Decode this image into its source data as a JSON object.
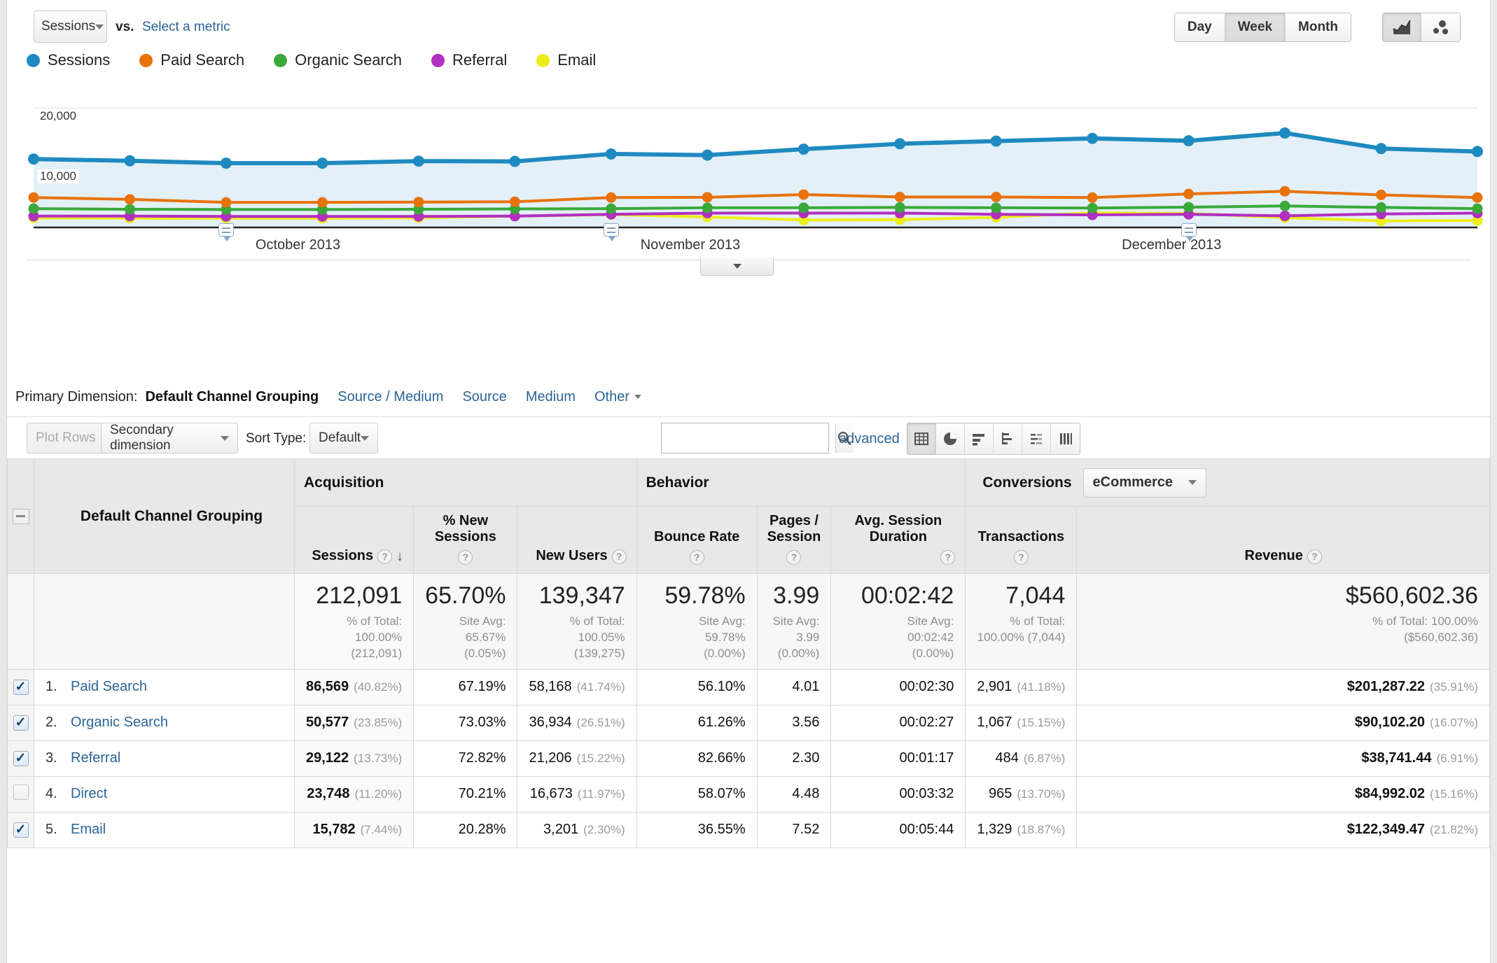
{
  "topbar": {
    "metric_select": "Sessions",
    "vs_label": "vs.",
    "select_metric_link": "Select a metric",
    "date_granularity": [
      "Day",
      "Week",
      "Month"
    ],
    "date_granularity_active": "Week",
    "chart_type_icons": [
      "line-chart-icon",
      "scatter-chart-icon"
    ],
    "chart_type_active": "line-chart-icon"
  },
  "legend": [
    {
      "label": "Sessions",
      "color": "#1f8ac0"
    },
    {
      "label": "Paid Search",
      "color": "#e8720c"
    },
    {
      "label": "Organic Search",
      "color": "#3aa93a"
    },
    {
      "label": "Referral",
      "color": "#b12fc1"
    },
    {
      "label": "Email",
      "color": "#eded1a"
    }
  ],
  "chart_data": {
    "type": "line",
    "title": "",
    "xlabel": "",
    "ylabel": "",
    "ylim": [
      0,
      24000
    ],
    "yticks": [
      "10,000",
      "20,000"
    ],
    "ytick_values": [
      10000,
      20000
    ],
    "grid": true,
    "legend_position": "top",
    "x": [
      "Sep 22, 2013",
      "Sep 29, 2013",
      "Oct 6, 2013",
      "Oct 13, 2013",
      "Oct 20, 2013",
      "Oct 27, 2013",
      "Nov 3, 2013",
      "Nov 10, 2013",
      "Nov 17, 2013",
      "Nov 24, 2013",
      "Dec 1, 2013",
      "Dec 8, 2013",
      "Dec 15, 2013",
      "Dec 22, 2013",
      "Dec 29, 2013",
      "Jan 5, 2014"
    ],
    "xtick_labels": [
      "October 2013",
      "November 2013",
      "December 2013"
    ],
    "series": [
      {
        "name": "Sessions",
        "color": "#1f8ac0",
        "values": [
          11450,
          11150,
          10750,
          10750,
          11100,
          11050,
          12300,
          12100,
          13100,
          14000,
          14450,
          14900,
          14500,
          15800,
          13200,
          12700
        ]
      },
      {
        "name": "Paid Search",
        "color": "#e8720c",
        "values": [
          5000,
          4700,
          4200,
          4200,
          4250,
          4300,
          5000,
          5050,
          5500,
          5100,
          5100,
          5000,
          5600,
          6050,
          5450,
          5000
        ]
      },
      {
        "name": "Organic Search",
        "color": "#3aa93a",
        "values": [
          3150,
          3050,
          3000,
          3000,
          3050,
          3100,
          3150,
          3300,
          3300,
          3350,
          3300,
          3250,
          3400,
          3600,
          3350,
          3150
        ]
      },
      {
        "name": "Referral",
        "color": "#b12fc1",
        "values": [
          1900,
          1900,
          1850,
          1850,
          1850,
          1900,
          2200,
          2400,
          2400,
          2400,
          2200,
          2100,
          2200,
          1950,
          2250,
          2400
        ]
      },
      {
        "name": "Email",
        "color": "#eded1a",
        "values": [
          1600,
          1550,
          1550,
          1550,
          1600,
          1900,
          2150,
          1750,
          1250,
          1300,
          1700,
          2450,
          2350,
          1650,
          1100,
          1150
        ]
      }
    ],
    "annotations": [
      {
        "x_label": "Oct 6, 2013",
        "icon": "annotation-icon"
      },
      {
        "x_label": "Nov 3, 2013",
        "icon": "annotation-icon"
      },
      {
        "x_label": "Dec 15, 2013",
        "icon": "annotation-icon"
      }
    ]
  },
  "primary_dimension": {
    "label": "Primary Dimension:",
    "current": "Default Channel Grouping",
    "links": [
      "Source / Medium",
      "Source",
      "Medium"
    ],
    "other": "Other"
  },
  "toolbar": {
    "plot_rows": "Plot Rows",
    "secondary_dimension": "Secondary dimension",
    "sort_type_label": "Sort Type:",
    "sort_type_value": "Default",
    "search_value": "",
    "search_placeholder": "",
    "advanced": "advanced",
    "view_icons": [
      "table-view-icon",
      "pie-view-icon",
      "bar-view-icon",
      "performance-view-icon",
      "comparison-view-icon",
      "pivot-view-icon"
    ],
    "view_active": "table-view-icon"
  },
  "table": {
    "group_headers": {
      "acquisition": "Acquisition",
      "behavior": "Behavior",
      "conversions": "Conversions",
      "conversions_select": "eCommerce"
    },
    "dimension_header": "Default Channel Grouping",
    "columns": [
      "Sessions",
      "% New Sessions",
      "New Users",
      "Bounce Rate",
      "Pages / Session",
      "Avg. Session Duration",
      "Transactions",
      "Revenue"
    ],
    "sorted_column": "Sessions",
    "sort_direction": "desc",
    "totals": [
      {
        "value": "212,091",
        "sub1": "% of Total:",
        "sub2": "100.00%",
        "sub3": "(212,091)"
      },
      {
        "value": "65.70%",
        "sub1": "Site Avg:",
        "sub2": "65.67%",
        "sub3": "(0.05%)"
      },
      {
        "value": "139,347",
        "sub1": "% of Total:",
        "sub2": "100.05%",
        "sub3": "(139,275)"
      },
      {
        "value": "59.78%",
        "sub1": "Site Avg:",
        "sub2": "59.78%",
        "sub3": "(0.00%)"
      },
      {
        "value": "3.99",
        "sub1": "Site Avg:",
        "sub2": "3.99",
        "sub3": "(0.00%)"
      },
      {
        "value": "00:02:42",
        "sub1": "Site Avg:",
        "sub2": "00:02:42",
        "sub3": "(0.00%)"
      },
      {
        "value": "7,044",
        "sub1": "% of Total:",
        "sub2": "100.00% (7,044)",
        "sub3": ""
      },
      {
        "value": "$560,602.36",
        "sub1": "% of Total: 100.00%",
        "sub2": "($560,602.36)",
        "sub3": ""
      }
    ],
    "rows": [
      {
        "checked": true,
        "index": "1.",
        "name": "Paid Search",
        "sessions": "86,569",
        "sessions_pct": "(40.82%)",
        "new_sessions_pct": "67.19%",
        "new_users": "58,168",
        "new_users_pct": "(41.74%)",
        "bounce_rate": "56.10%",
        "pages_session": "4.01",
        "avg_duration": "00:02:30",
        "transactions": "2,901",
        "transactions_pct": "(41.18%)",
        "revenue": "$201,287.22",
        "revenue_pct": "(35.91%)"
      },
      {
        "checked": true,
        "index": "2.",
        "name": "Organic Search",
        "sessions": "50,577",
        "sessions_pct": "(23.85%)",
        "new_sessions_pct": "73.03%",
        "new_users": "36,934",
        "new_users_pct": "(26.51%)",
        "bounce_rate": "61.26%",
        "pages_session": "3.56",
        "avg_duration": "00:02:27",
        "transactions": "1,067",
        "transactions_pct": "(15.15%)",
        "revenue": "$90,102.20",
        "revenue_pct": "(16.07%)"
      },
      {
        "checked": true,
        "index": "3.",
        "name": "Referral",
        "sessions": "29,122",
        "sessions_pct": "(13.73%)",
        "new_sessions_pct": "72.82%",
        "new_users": "21,206",
        "new_users_pct": "(15.22%)",
        "bounce_rate": "82.66%",
        "pages_session": "2.30",
        "avg_duration": "00:01:17",
        "transactions": "484",
        "transactions_pct": "(6.87%)",
        "revenue": "$38,741.44",
        "revenue_pct": "(6.91%)"
      },
      {
        "checked": false,
        "index": "4.",
        "name": "Direct",
        "sessions": "23,748",
        "sessions_pct": "(11.20%)",
        "new_sessions_pct": "70.21%",
        "new_users": "16,673",
        "new_users_pct": "(11.97%)",
        "bounce_rate": "58.07%",
        "pages_session": "4.48",
        "avg_duration": "00:03:32",
        "transactions": "965",
        "transactions_pct": "(13.70%)",
        "revenue": "$84,992.02",
        "revenue_pct": "(15.16%)"
      },
      {
        "checked": true,
        "index": "5.",
        "name": "Email",
        "sessions": "15,782",
        "sessions_pct": "(7.44%)",
        "new_sessions_pct": "20.28%",
        "new_users": "3,201",
        "new_users_pct": "(2.30%)",
        "bounce_rate": "36.55%",
        "pages_session": "7.52",
        "avg_duration": "00:05:44",
        "transactions": "1,329",
        "transactions_pct": "(18.87%)",
        "revenue": "$122,349.47",
        "revenue_pct": "(21.82%)"
      }
    ]
  }
}
